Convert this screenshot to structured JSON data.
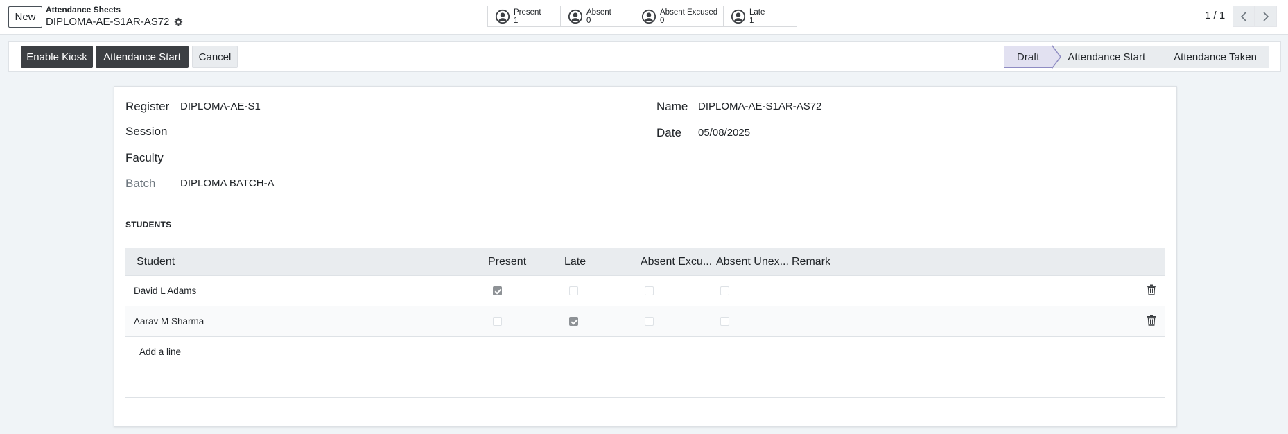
{
  "topbar": {
    "new_label": "New",
    "breadcrumb": "Attendance Sheets",
    "record_name": "DIPLOMA-AE-S1AR-AS72",
    "pager": "1 / 1"
  },
  "smart_buttons": [
    {
      "label": "Present",
      "value": "1",
      "icon": "person-circle-icon"
    },
    {
      "label": "Absent",
      "value": "0",
      "icon": "person-circle-icon"
    },
    {
      "label": "Absent Excused",
      "value": "0",
      "icon": "person-circle-icon"
    },
    {
      "label": "Late",
      "value": "1",
      "icon": "person-circle-icon"
    }
  ],
  "statusbar": {
    "enable_kiosk": "Enable Kiosk",
    "attendance_start": "Attendance Start",
    "cancel": "Cancel",
    "stages": [
      "Draft",
      "Attendance Start",
      "Attendance Taken"
    ],
    "active_stage": "Draft"
  },
  "form": {
    "register_label": "Register",
    "register_value": "DIPLOMA-AE-S1",
    "session_label": "Session",
    "session_value": "",
    "faculty_label": "Faculty",
    "faculty_value": "",
    "batch_label": "Batch",
    "batch_value": "DIPLOMA BATCH-A",
    "name_label": "Name",
    "name_value": "DIPLOMA-AE-S1AR-AS72",
    "date_label": "Date",
    "date_value": "05/08/2025"
  },
  "students": {
    "section_title": "STUDENTS",
    "columns": [
      "Student",
      "Present",
      "Late",
      "Absent Excu...",
      "Absent Unex...",
      "Remark"
    ],
    "rows": [
      {
        "student": "David L Adams",
        "present": true,
        "late": false,
        "absent_excused": false,
        "absent_unexcused": false,
        "remark": ""
      },
      {
        "student": "Aarav M Sharma",
        "present": false,
        "late": true,
        "absent_excused": false,
        "absent_unexcused": false,
        "remark": ""
      }
    ],
    "add_line": "Add a line"
  },
  "colors": {
    "primary_dark": "#3c3f43",
    "active_stage_bg": "#e2e1f1",
    "active_stage_border": "#8f8cc3",
    "background": "#f0f4f7"
  }
}
